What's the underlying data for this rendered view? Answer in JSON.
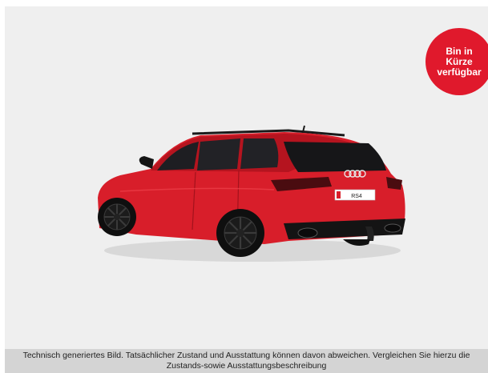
{
  "badge": {
    "line1": "Bin in",
    "line2": "Kürze",
    "line3": "verfügbar",
    "color": "#e0192c"
  },
  "car": {
    "body_color": "#d81e2a",
    "plate_text": "RS4",
    "image_name": "car-rear-three-quarter-icon"
  },
  "disclaimer": {
    "text": "Technisch generiertes Bild. Tatsächlicher Zustand und Ausstattung können davon abweichen. Vergleichen Sie hierzu die Zustands-sowie Ausstattungsbeschreibung"
  }
}
